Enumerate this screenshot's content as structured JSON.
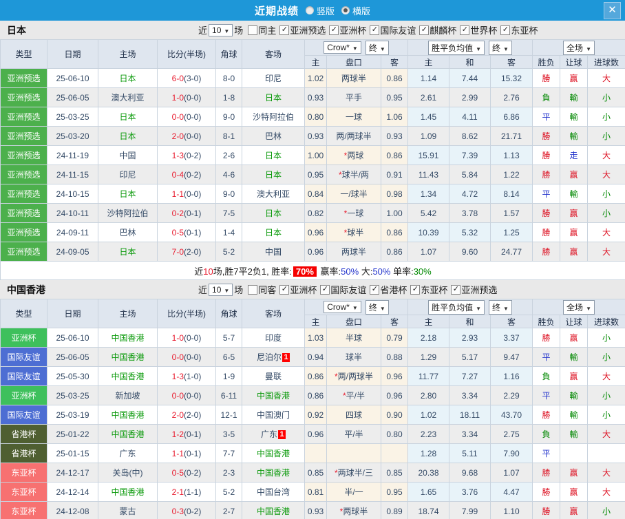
{
  "titlebar": {
    "title": "近期战绩",
    "radio_vertical": "竖版",
    "radio_horizontal": "横版",
    "close_glyph": "✕"
  },
  "filter_labels": {
    "near": "近",
    "games": "场"
  },
  "table_headers": {
    "col_type": "类型",
    "col_date": "日期",
    "col_home": "主场",
    "col_score": "比分(半场)",
    "col_corner": "角球",
    "col_away": "客场",
    "dd_bookmaker": "Crow*",
    "dd_final": "终",
    "dd_avg": "胜平负均值",
    "dd_full": "全场",
    "sub_home": "主",
    "sub_handicap": "盘口",
    "sub_away": "客",
    "sub_avg_home": "主",
    "sub_avg_draw": "和",
    "sub_avg_away": "客",
    "sub_wdl": "胜负",
    "sub_let": "让球",
    "sub_goals": "进球数"
  },
  "colors": {
    "topbar_blue": "#1e97d8",
    "score_red": "#e8192c",
    "team_green": "#099909",
    "type_colors": {
      "亚洲预选": "#4cb04c",
      "亚洲杯": "#3ec05c",
      "国际友谊": "#4d6ed3",
      "省港杯": "#4f5f31",
      "东亚杯": "#f77171"
    },
    "result_colors": {
      "勝": "#dd1122",
      "負": "#008800",
      "平": "#2233cc",
      "赢": "#dd1122",
      "輸": "#008800",
      "走": "#2233cc",
      "大": "#dd1122",
      "小": "#008800"
    }
  },
  "sections": [
    {
      "team": "日本",
      "match_count": "10",
      "same_label": "同主",
      "same_checked": false,
      "competitions": [
        {
          "label": "亚洲预选",
          "checked": true
        },
        {
          "label": "亚洲杯",
          "checked": true
        },
        {
          "label": "国际友谊",
          "checked": true
        },
        {
          "label": "麒麟杯",
          "checked": true
        },
        {
          "label": "世界杯",
          "checked": true
        },
        {
          "label": "东亚杯",
          "checked": true
        }
      ],
      "rows": [
        {
          "type": "亚洲预选",
          "date": "25-06-10",
          "home": "日本",
          "home_self": true,
          "score": "6-0",
          "half": "(3-0)",
          "corner": "8-0",
          "away": "印尼",
          "away_self": false,
          "away_card": "",
          "crow_home": "1.02",
          "handicap": "两球半",
          "crow_away": "0.86",
          "avg_home": "1.14",
          "avg_draw": "7.44",
          "avg_away": "15.32",
          "wdl": "勝",
          "let": "赢",
          "goal": "大"
        },
        {
          "type": "亚洲预选",
          "date": "25-06-05",
          "home": "澳大利亚",
          "home_self": false,
          "score": "1-0",
          "half": "(0-0)",
          "corner": "1-8",
          "away": "日本",
          "away_self": true,
          "away_card": "",
          "crow_home": "0.93",
          "handicap": "平手",
          "crow_away": "0.95",
          "avg_home": "2.61",
          "avg_draw": "2.99",
          "avg_away": "2.76",
          "wdl": "負",
          "let": "輸",
          "goal": "小"
        },
        {
          "type": "亚洲预选",
          "date": "25-03-25",
          "home": "日本",
          "home_self": true,
          "score": "0-0",
          "half": "(0-0)",
          "corner": "9-0",
          "away": "沙特阿拉伯",
          "away_self": false,
          "away_card": "",
          "crow_home": "0.80",
          "handicap": "一球",
          "crow_away": "1.06",
          "avg_home": "1.45",
          "avg_draw": "4.11",
          "avg_away": "6.86",
          "wdl": "平",
          "let": "輸",
          "goal": "小"
        },
        {
          "type": "亚洲预选",
          "date": "25-03-20",
          "home": "日本",
          "home_self": true,
          "score": "2-0",
          "half": "(0-0)",
          "corner": "8-1",
          "away": "巴林",
          "away_self": false,
          "away_card": "",
          "crow_home": "0.93",
          "handicap": "两/两球半",
          "crow_away": "0.93",
          "avg_home": "1.09",
          "avg_draw": "8.62",
          "avg_away": "21.71",
          "wdl": "勝",
          "let": "輸",
          "goal": "小"
        },
        {
          "type": "亚洲预选",
          "date": "24-11-19",
          "home": "中国",
          "home_self": false,
          "score": "1-3",
          "half": "(0-2)",
          "corner": "2-6",
          "away": "日本",
          "away_self": true,
          "away_card": "",
          "crow_home": "1.00",
          "handicap": "*两球",
          "crow_away": "0.86",
          "avg_home": "15.91",
          "avg_draw": "7.39",
          "avg_away": "1.13",
          "wdl": "勝",
          "let": "走",
          "goal": "大"
        },
        {
          "type": "亚洲预选",
          "date": "24-11-15",
          "home": "印尼",
          "home_self": false,
          "score": "0-4",
          "half": "(0-2)",
          "corner": "4-6",
          "away": "日本",
          "away_self": true,
          "away_card": "",
          "crow_home": "0.95",
          "handicap": "*球半/两",
          "crow_away": "0.91",
          "avg_home": "11.43",
          "avg_draw": "5.84",
          "avg_away": "1.22",
          "wdl": "勝",
          "let": "赢",
          "goal": "大"
        },
        {
          "type": "亚洲预选",
          "date": "24-10-15",
          "home": "日本",
          "home_self": true,
          "score": "1-1",
          "half": "(0-0)",
          "corner": "9-0",
          "away": "澳大利亚",
          "away_self": false,
          "away_card": "",
          "crow_home": "0.84",
          "handicap": "一/球半",
          "crow_away": "0.98",
          "avg_home": "1.34",
          "avg_draw": "4.72",
          "avg_away": "8.14",
          "wdl": "平",
          "let": "輸",
          "goal": "小"
        },
        {
          "type": "亚洲预选",
          "date": "24-10-11",
          "home": "沙特阿拉伯",
          "home_self": false,
          "score": "0-2",
          "half": "(0-1)",
          "corner": "7-5",
          "away": "日本",
          "away_self": true,
          "away_card": "",
          "crow_home": "0.82",
          "handicap": "*一球",
          "crow_away": "1.00",
          "avg_home": "5.42",
          "avg_draw": "3.78",
          "avg_away": "1.57",
          "wdl": "勝",
          "let": "赢",
          "goal": "小"
        },
        {
          "type": "亚洲预选",
          "date": "24-09-11",
          "home": "巴林",
          "home_self": false,
          "score": "0-5",
          "half": "(0-1)",
          "corner": "1-4",
          "away": "日本",
          "away_self": true,
          "away_card": "",
          "crow_home": "0.96",
          "handicap": "*球半",
          "crow_away": "0.86",
          "avg_home": "10.39",
          "avg_draw": "5.32",
          "avg_away": "1.25",
          "wdl": "勝",
          "let": "赢",
          "goal": "大"
        },
        {
          "type": "亚洲预选",
          "date": "24-09-05",
          "home": "日本",
          "home_self": true,
          "score": "7-0",
          "half": "(2-0)",
          "corner": "5-2",
          "away": "中国",
          "away_self": false,
          "away_card": "",
          "crow_home": "0.96",
          "handicap": "两球半",
          "crow_away": "0.86",
          "avg_home": "1.07",
          "avg_draw": "9.60",
          "avg_away": "24.77",
          "wdl": "勝",
          "let": "赢",
          "goal": "大"
        }
      ],
      "summary": [
        {
          "text": "近"
        },
        {
          "text": "10",
          "style": "red"
        },
        {
          "text": "场,胜7平2负1, 胜率:"
        },
        {
          "text": "70%",
          "style": "hl"
        },
        {
          "text": " 赢率:"
        },
        {
          "text": "50%",
          "style": "blue"
        },
        {
          "text": " 大:"
        },
        {
          "text": "50%",
          "style": "blue"
        },
        {
          "text": " 单率:"
        },
        {
          "text": "30%",
          "style": "green"
        }
      ]
    },
    {
      "team": "中国香港",
      "match_count": "10",
      "same_label": "同客",
      "same_checked": false,
      "competitions": [
        {
          "label": "亚洲杯",
          "checked": true
        },
        {
          "label": "国际友谊",
          "checked": true
        },
        {
          "label": "省港杯",
          "checked": true
        },
        {
          "label": "东亚杯",
          "checked": true
        },
        {
          "label": "亚洲预选",
          "checked": true
        }
      ],
      "rows": [
        {
          "type": "亚洲杯",
          "date": "25-06-10",
          "home": "中国香港",
          "home_self": true,
          "score": "1-0",
          "half": "(0-0)",
          "corner": "5-7",
          "away": "印度",
          "away_self": false,
          "away_card": "",
          "crow_home": "1.03",
          "handicap": "半球",
          "crow_away": "0.79",
          "avg_home": "2.18",
          "avg_draw": "2.93",
          "avg_away": "3.37",
          "wdl": "勝",
          "let": "赢",
          "goal": "小"
        },
        {
          "type": "国际友谊",
          "date": "25-06-05",
          "home": "中国香港",
          "home_self": true,
          "score": "0-0",
          "half": "(0-0)",
          "corner": "6-5",
          "away": "尼泊尔",
          "away_self": false,
          "away_card": "1",
          "crow_home": "0.94",
          "handicap": "球半",
          "crow_away": "0.88",
          "avg_home": "1.29",
          "avg_draw": "5.17",
          "avg_away": "9.47",
          "wdl": "平",
          "let": "輸",
          "goal": "小"
        },
        {
          "type": "国际友谊",
          "date": "25-05-30",
          "home": "中国香港",
          "home_self": true,
          "score": "1-3",
          "half": "(1-0)",
          "corner": "1-9",
          "away": "曼联",
          "away_self": false,
          "away_card": "",
          "crow_home": "0.86",
          "handicap": "*两/两球半",
          "crow_away": "0.96",
          "avg_home": "11.77",
          "avg_draw": "7.27",
          "avg_away": "1.16",
          "wdl": "負",
          "let": "赢",
          "goal": "大"
        },
        {
          "type": "亚洲杯",
          "date": "25-03-25",
          "home": "新加坡",
          "home_self": false,
          "score": "0-0",
          "half": "(0-0)",
          "corner": "6-11",
          "away": "中国香港",
          "away_self": true,
          "away_card": "",
          "crow_home": "0.86",
          "handicap": "*平/半",
          "crow_away": "0.96",
          "avg_home": "2.80",
          "avg_draw": "3.34",
          "avg_away": "2.29",
          "wdl": "平",
          "let": "輸",
          "goal": "小"
        },
        {
          "type": "国际友谊",
          "date": "25-03-19",
          "home": "中国香港",
          "home_self": true,
          "score": "2-0",
          "half": "(2-0)",
          "corner": "12-1",
          "away": "中国澳门",
          "away_self": false,
          "away_card": "",
          "crow_home": "0.92",
          "handicap": "四球",
          "crow_away": "0.90",
          "avg_home": "1.02",
          "avg_draw": "18.11",
          "avg_away": "43.70",
          "wdl": "勝",
          "let": "輸",
          "goal": "小"
        },
        {
          "type": "省港杯",
          "date": "25-01-22",
          "home": "中国香港",
          "home_self": true,
          "score": "1-2",
          "half": "(0-1)",
          "corner": "3-5",
          "away": "广东",
          "away_self": false,
          "away_card": "1",
          "crow_home": "0.96",
          "handicap": "平/半",
          "crow_away": "0.80",
          "avg_home": "2.23",
          "avg_draw": "3.34",
          "avg_away": "2.75",
          "wdl": "負",
          "let": "輸",
          "goal": "大"
        },
        {
          "type": "省港杯",
          "date": "25-01-15",
          "home": "广东",
          "home_self": false,
          "score": "1-1",
          "half": "(0-1)",
          "corner": "7-7",
          "away": "中国香港",
          "away_self": true,
          "away_card": "",
          "crow_home": "",
          "handicap": "",
          "crow_away": "",
          "avg_home": "1.28",
          "avg_draw": "5.11",
          "avg_away": "7.90",
          "wdl": "平",
          "let": "",
          "goal": ""
        },
        {
          "type": "东亚杯",
          "date": "24-12-17",
          "home": "关岛(中)",
          "home_self": false,
          "score": "0-5",
          "half": "(0-2)",
          "corner": "2-3",
          "away": "中国香港",
          "away_self": true,
          "away_card": "",
          "crow_home": "0.85",
          "handicap": "*两球半/三",
          "crow_away": "0.85",
          "avg_home": "20.38",
          "avg_draw": "9.68",
          "avg_away": "1.07",
          "wdl": "勝",
          "let": "赢",
          "goal": "大"
        },
        {
          "type": "东亚杯",
          "date": "24-12-14",
          "home": "中国香港",
          "home_self": true,
          "score": "2-1",
          "half": "(1-1)",
          "corner": "5-2",
          "away": "中国台湾",
          "away_self": false,
          "away_card": "",
          "crow_home": "0.81",
          "handicap": "半/一",
          "crow_away": "0.95",
          "avg_home": "1.65",
          "avg_draw": "3.76",
          "avg_away": "4.47",
          "wdl": "勝",
          "let": "赢",
          "goal": "大"
        },
        {
          "type": "东亚杯",
          "date": "24-12-08",
          "home": "蒙古",
          "home_self": false,
          "score": "0-3",
          "half": "(0-2)",
          "corner": "2-7",
          "away": "中国香港",
          "away_self": true,
          "away_card": "",
          "crow_home": "0.93",
          "handicap": "*两球半",
          "crow_away": "0.89",
          "avg_home": "18.74",
          "avg_draw": "7.99",
          "avg_away": "1.10",
          "wdl": "勝",
          "let": "赢",
          "goal": "小"
        }
      ],
      "summary": null
    }
  ]
}
